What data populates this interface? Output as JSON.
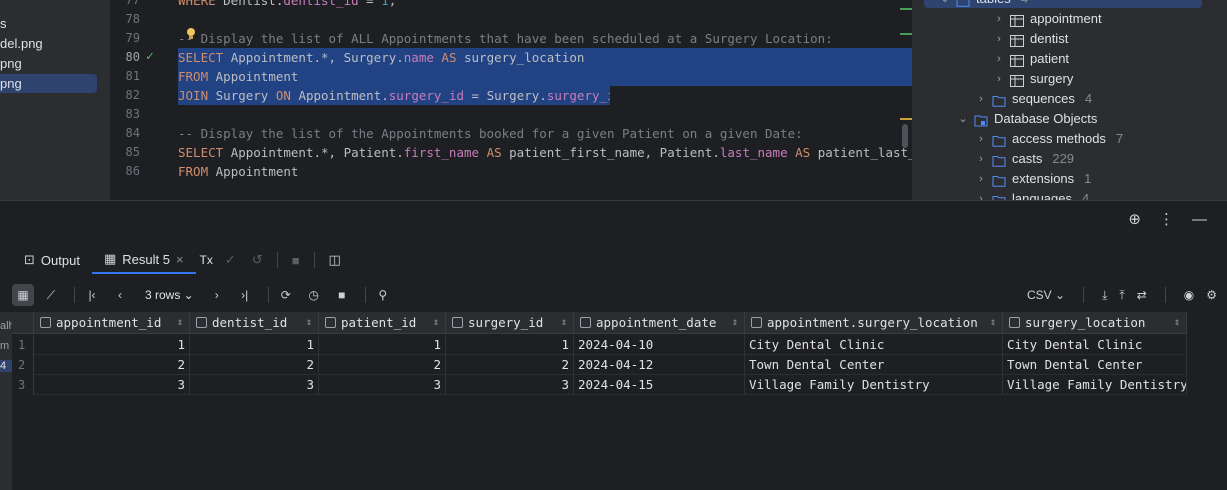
{
  "files": [
    {
      "name": "s",
      "selected": false
    },
    {
      "name": "del.png",
      "selected": false
    },
    {
      "name": "png",
      "selected": false
    },
    {
      "name": "png",
      "selected": true
    }
  ],
  "editor": {
    "lines": [
      {
        "n": "77",
        "tokens": [
          [
            "kw",
            "WHERE "
          ],
          [
            "id",
            "Dentist."
          ],
          [
            "fld",
            "dentist_id"
          ],
          [
            "id",
            " = "
          ],
          [
            "num",
            "1"
          ],
          [
            "id",
            ";"
          ]
        ]
      },
      {
        "n": "78",
        "tokens": []
      },
      {
        "n": "79",
        "tokens": [
          [
            "cm",
            "-- Display the list of ALL Appointments that have been scheduled at a Surgery Location:"
          ]
        ]
      },
      {
        "n": "80",
        "current": true,
        "highlight": true,
        "tokens": [
          [
            "kw",
            "SELECT "
          ],
          [
            "id",
            "Appointment.*, Surgery."
          ],
          [
            "fld",
            "name"
          ],
          [
            "kw",
            " AS "
          ],
          [
            "id",
            "surgery_location"
          ]
        ]
      },
      {
        "n": "81",
        "highlight": true,
        "tokens": [
          [
            "kw",
            "FROM "
          ],
          [
            "id",
            "Appointment"
          ]
        ]
      },
      {
        "n": "82",
        "highlight": true,
        "tokens": [
          [
            "kw",
            "JOIN "
          ],
          [
            "id",
            "Surgery "
          ],
          [
            "kw",
            "ON "
          ],
          [
            "id",
            "Appointment."
          ],
          [
            "fld",
            "surgery_id"
          ],
          [
            "id",
            " = Surgery."
          ],
          [
            "fld",
            "surgery_id"
          ],
          [
            "id",
            ";"
          ]
        ]
      },
      {
        "n": "83",
        "tokens": []
      },
      {
        "n": "84",
        "tokens": [
          [
            "cm",
            "-- Display the list of the Appointments booked for a given Patient on a given Date:"
          ]
        ]
      },
      {
        "n": "85",
        "tokens": [
          [
            "kw",
            "SELECT "
          ],
          [
            "id",
            "Appointment.*, Patient."
          ],
          [
            "fld",
            "first_name"
          ],
          [
            "kw",
            " AS "
          ],
          [
            "id",
            "patient_first_name, Patient."
          ],
          [
            "fld",
            "last_name"
          ],
          [
            "kw",
            " AS "
          ],
          [
            "id",
            "patient_last_name"
          ]
        ]
      },
      {
        "n": "86",
        "tokens": [
          [
            "kw",
            "FROM "
          ],
          [
            "id",
            "Appointment"
          ]
        ]
      }
    ]
  },
  "db_tree": [
    {
      "label": "tables",
      "count": "4",
      "indent": 0,
      "type": "folder",
      "chev": "v"
    },
    {
      "label": "appointment",
      "count": "",
      "indent": 3,
      "type": "table",
      "chev": ">"
    },
    {
      "label": "dentist",
      "count": "",
      "indent": 3,
      "type": "table",
      "chev": ">"
    },
    {
      "label": "patient",
      "count": "",
      "indent": 3,
      "type": "table",
      "chev": ">"
    },
    {
      "label": "surgery",
      "count": "",
      "indent": 3,
      "type": "table",
      "chev": ">"
    },
    {
      "label": "sequences",
      "count": "4",
      "indent": 2,
      "type": "folder",
      "chev": ">"
    },
    {
      "label": "Database Objects",
      "count": "",
      "indent": 1,
      "type": "dbobj",
      "chev": "v"
    },
    {
      "label": "access methods",
      "count": "7",
      "indent": 2,
      "type": "folder",
      "chev": ">"
    },
    {
      "label": "casts",
      "count": "229",
      "indent": 2,
      "type": "folder",
      "chev": ">"
    },
    {
      "label": "extensions",
      "count": "1",
      "indent": 2,
      "type": "folder",
      "chev": ">"
    },
    {
      "label": "languages",
      "count": "4",
      "indent": 2,
      "type": "folder",
      "chev": ">"
    }
  ],
  "tabs": {
    "output": "Output",
    "result": "Result 5",
    "tx": "Tx"
  },
  "toolbar": {
    "rows": "3 rows",
    "format": "CSV"
  },
  "grid": {
    "columns": [
      "appointment_id",
      "dentist_id",
      "patient_id",
      "surgery_id",
      "appointment_date",
      "appointment.surgery_location",
      "surgery_location"
    ],
    "rows": [
      {
        "n": "1",
        "cells": [
          "1",
          "1",
          "1",
          "1",
          "2024-04-10",
          "City Dental Clinic",
          "City Dental Clinic"
        ]
      },
      {
        "n": "2",
        "cells": [
          "2",
          "2",
          "2",
          "2",
          "2024-04-12",
          "Town Dental Center",
          "Town Dental Center"
        ]
      },
      {
        "n": "3",
        "cells": [
          "3",
          "3",
          "3",
          "3",
          "2024-04-15",
          "Village Family Dentistry",
          "Village Family Dentistry"
        ]
      }
    ]
  },
  "left_strip": [
    "alh",
    "m",
    "4"
  ]
}
